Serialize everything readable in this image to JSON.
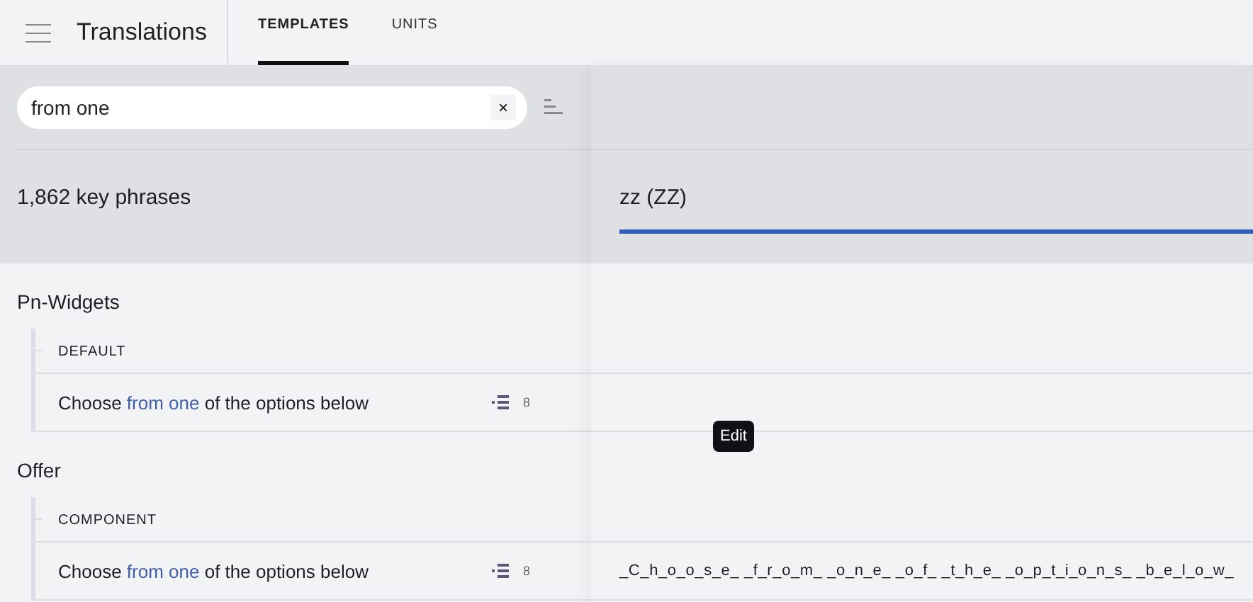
{
  "app": {
    "title": "Translations"
  },
  "tabs": [
    {
      "label": "TEMPLATES",
      "selected": true
    },
    {
      "label": "UNITS",
      "selected": false
    }
  ],
  "search": {
    "value": "from one",
    "clear": "×"
  },
  "count": "1,862 key phrases",
  "language": {
    "label": "zz (ZZ)",
    "selected": true
  },
  "groups": [
    {
      "name": "Pn-Widgets",
      "sections": [
        {
          "name": "DEFAULT",
          "phrases": [
            {
              "before": "Choose ",
              "match": "from one",
              "after": " of the options below",
              "count": "8"
            }
          ]
        }
      ]
    },
    {
      "name": "Offer",
      "sections": [
        {
          "name": "COMPONENT",
          "phrases": [
            {
              "before": "Choose ",
              "match": "from one",
              "after": " of the options below",
              "count": "8",
              "translation": "_C_h_o_o_s_e_ _f_r_o_m_ _o_n_e_ _o_f_ _t_h_e_ _o_p_t_i_o_n_s_ _b_e_l_o_w_"
            }
          ]
        }
      ]
    }
  ],
  "tooltip": "Edit"
}
